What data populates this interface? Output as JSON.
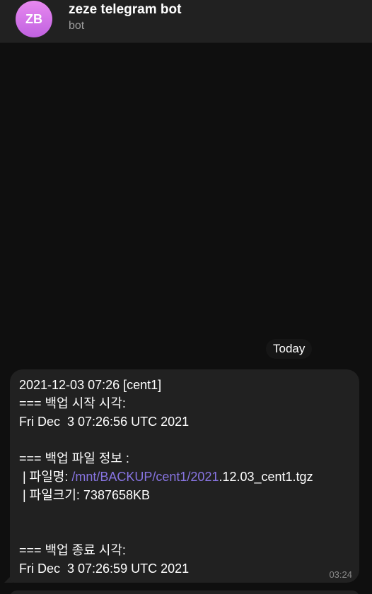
{
  "header": {
    "avatar_initials": "ZB",
    "title": "zeze telegram bot",
    "subtitle": "bot"
  },
  "date_separator": "Today",
  "message": {
    "line1": "2021-12-03 07:26 [cent1]",
    "line2": "=== 백업 시작 시각:",
    "line3": "Fri Dec  3 07:26:56 UTC 2021",
    "line4": "=== 백업 파일 정보 :",
    "line5_prefix": " | 파일명: ",
    "line5_link": "/mnt/BACKUP/cent1/2021",
    "line5_suffix": ".12.03_cent1.tgz",
    "line6": " | 파일크기: 7387658KB",
    "line7": "=== 백업 종료 시각:",
    "line8": "Fri Dec  3 07:26:59 UTC 2021",
    "time": "03:24"
  }
}
